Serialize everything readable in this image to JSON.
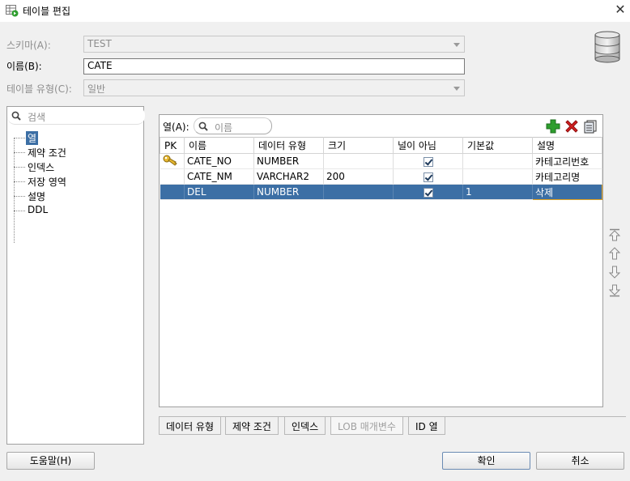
{
  "window": {
    "title": "테이블 편집",
    "close_glyph": "✕"
  },
  "form": {
    "schema_label": "스키마(A):",
    "schema_value": "TEST",
    "name_label": "이름(B):",
    "name_value": "CATE",
    "table_type_label": "테이블 유형(C):",
    "table_type_value": "일반"
  },
  "nav": {
    "search_placeholder": "검색",
    "items": [
      "열",
      "제약 조건",
      "인덱스",
      "저장 영역",
      "설명",
      "DDL"
    ],
    "selected_index": 0
  },
  "columns_panel": {
    "filter_label": "열(A):",
    "filter_placeholder": "이름",
    "headers": [
      "PK",
      "이름",
      "데이터 유형",
      "크기",
      "널이 아님",
      "기본값",
      "설명"
    ],
    "rows": [
      {
        "pk": true,
        "name": "CATE_NO",
        "type": "NUMBER",
        "size": "",
        "not_null": true,
        "default": "",
        "comment": "카테고리번호"
      },
      {
        "pk": false,
        "name": "CATE_NM",
        "type": "VARCHAR2",
        "size": "200",
        "not_null": true,
        "default": "",
        "comment": "카테고리명"
      },
      {
        "pk": false,
        "name": "DEL",
        "type": "NUMBER",
        "size": "",
        "not_null": true,
        "default": "1",
        "comment": "삭제"
      }
    ],
    "selected_row": 2
  },
  "tabs": [
    "데이터 유형",
    "제약 조건",
    "인덱스",
    "LOB 매개변수",
    "ID 열"
  ],
  "buttons": {
    "help": "도움말(H)",
    "ok": "확인",
    "cancel": "취소"
  },
  "colors": {
    "selection": "#3c6fa5",
    "add_icon": "#2e9e2e",
    "delete_icon": "#d42020"
  }
}
